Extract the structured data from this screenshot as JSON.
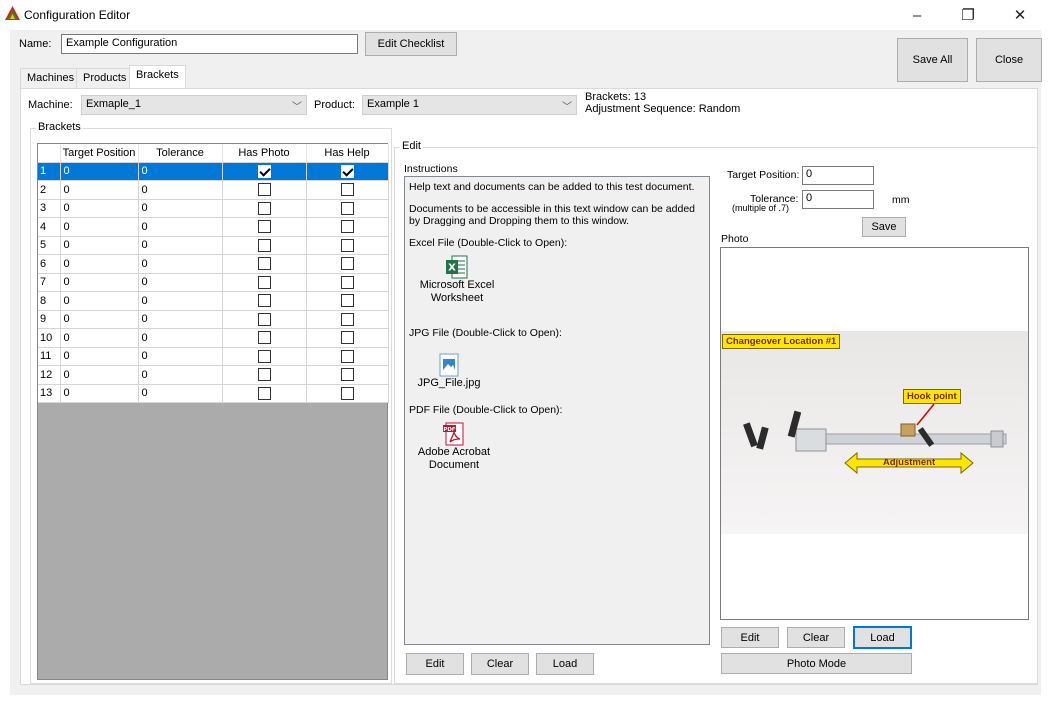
{
  "window": {
    "title": "Configuration Editor",
    "controls": {
      "minimize": "–",
      "restore": "❐",
      "close": "✕"
    }
  },
  "header": {
    "name_label": "Name:",
    "name_value": "Example Configuration",
    "edit_checklist_label": "Edit Checklist",
    "save_all_label": "Save All",
    "close_label": "Close"
  },
  "tabs": [
    {
      "label": "Machines"
    },
    {
      "label": "Products"
    },
    {
      "label": "Brackets"
    }
  ],
  "filters": {
    "machine_label": "Machine:",
    "machine_value": "Exmaple_1",
    "product_label": "Product:",
    "product_value": "Example 1",
    "brackets_info": "Brackets: 13",
    "sequence_info": "Adjustment Sequence: Random"
  },
  "brackets_group": {
    "label": "Brackets",
    "columns": [
      "",
      "Target Position",
      "Tolerance",
      "Has Photo",
      "Has Help"
    ],
    "rows": [
      {
        "num": "1",
        "target": "0",
        "tolerance": "0",
        "has_photo": true,
        "has_help": true
      },
      {
        "num": "2",
        "target": "0",
        "tolerance": "0",
        "has_photo": false,
        "has_help": false
      },
      {
        "num": "3",
        "target": "0",
        "tolerance": "0",
        "has_photo": false,
        "has_help": false
      },
      {
        "num": "4",
        "target": "0",
        "tolerance": "0",
        "has_photo": false,
        "has_help": false
      },
      {
        "num": "5",
        "target": "0",
        "tolerance": "0",
        "has_photo": false,
        "has_help": false
      },
      {
        "num": "6",
        "target": "0",
        "tolerance": "0",
        "has_photo": false,
        "has_help": false
      },
      {
        "num": "7",
        "target": "0",
        "tolerance": "0",
        "has_photo": false,
        "has_help": false
      },
      {
        "num": "8",
        "target": "0",
        "tolerance": "0",
        "has_photo": false,
        "has_help": false
      },
      {
        "num": "9",
        "target": "0",
        "tolerance": "0",
        "has_photo": false,
        "has_help": false
      },
      {
        "num": "10",
        "target": "0",
        "tolerance": "0",
        "has_photo": false,
        "has_help": false
      },
      {
        "num": "11",
        "target": "0",
        "tolerance": "0",
        "has_photo": false,
        "has_help": false
      },
      {
        "num": "12",
        "target": "0",
        "tolerance": "0",
        "has_photo": false,
        "has_help": false
      },
      {
        "num": "13",
        "target": "0",
        "tolerance": "0",
        "has_photo": false,
        "has_help": false
      }
    ]
  },
  "edit_group": {
    "label": "Edit",
    "instructions_label": "Instructions",
    "instructions": {
      "line1": "Help text and documents can be added to this test document.",
      "line2": "Documents to be accessible in this text window can be added by Dragging and Dropping them to this window.",
      "excel_heading": "Excel File (Double-Click to Open):",
      "excel_caption_1": "Microsoft Excel",
      "excel_caption_2": "Worksheet",
      "jpg_heading": "JPG File (Double-Click to Open):",
      "jpg_caption": "JPG_File.jpg",
      "pdf_heading": "PDF File (Double-Click to Open):",
      "pdf_caption_1": "Adobe Acrobat",
      "pdf_caption_2": "Document"
    },
    "instr_buttons": {
      "edit": "Edit",
      "clear": "Clear",
      "load": "Load"
    },
    "target_position_label": "Target Position:",
    "target_position_value": "0",
    "tolerance_label": "Tolerance:",
    "tolerance_note": "(multiple of .7)",
    "tolerance_value": "0",
    "tolerance_unit": "mm",
    "save_label": "Save",
    "photo_label": "Photo",
    "photo_tags": {
      "location": "Changeover Location #1",
      "hook": "Hook point",
      "adjustment": "Adjustment"
    },
    "photo_buttons": {
      "edit": "Edit",
      "clear": "Clear",
      "load": "Load",
      "photo_mode": "Photo Mode"
    }
  },
  "colors": {
    "selection": "#0078d7",
    "window_bg": "#f0f0f0",
    "grid_empty": "#ababab",
    "tag_yellow": "#ffe600"
  }
}
